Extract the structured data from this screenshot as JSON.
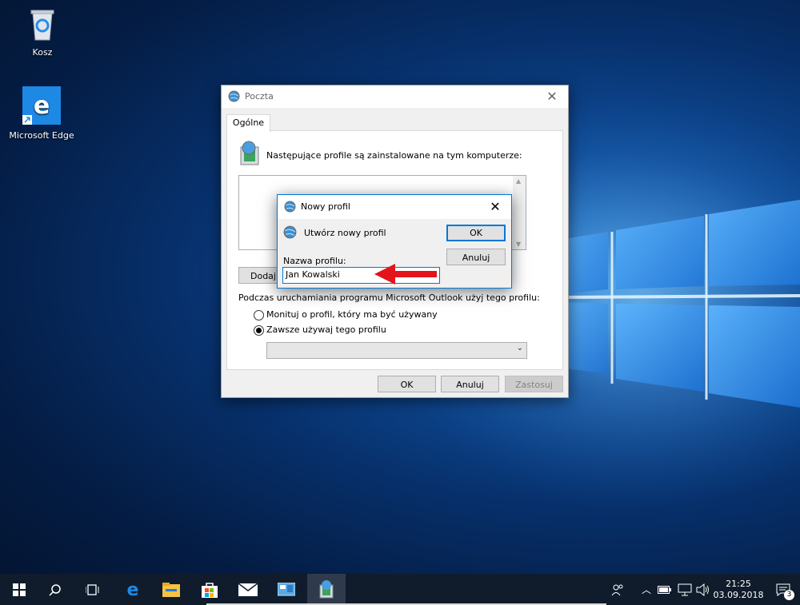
{
  "desktop": {
    "icons": [
      {
        "label": "Kosz",
        "icon": "recycle-bin-icon"
      },
      {
        "label": "Microsoft Edge",
        "icon": "edge-icon"
      }
    ]
  },
  "mail_dialog": {
    "title": "Poczta",
    "tab": "Ogólne",
    "header_text": "Następujące profile są zainstalowane na tym komputerze:",
    "add_button_partial": "Dodaj...",
    "startup_label": "Podczas uruchamiania programu Microsoft Outlook użyj tego profilu:",
    "radio_prompt": "Monituj o profil, który ma być używany",
    "radio_always": "Zawsze używaj tego profilu",
    "selected_radio": "radio_always",
    "profile_select_value": "",
    "ok": "OK",
    "cancel": "Anuluj",
    "apply": "Zastosuj"
  },
  "new_profile_dialog": {
    "title": "Nowy profil",
    "header_text": "Utwórz nowy profil",
    "field_label": "Nazwa profilu:",
    "field_value": "Jan Kowalski",
    "ok": "OK",
    "cancel": "Anuluj"
  },
  "annotation": {
    "color": "#e3141b",
    "icon": "red-arrow-icon"
  },
  "taskbar": {
    "items": [
      "start-icon",
      "search-icon",
      "task-view-icon",
      "edge-icon",
      "file-explorer-icon",
      "store-icon",
      "mail-icon",
      "control-panel-icon",
      "mail-profile-icon"
    ],
    "active": "mail-profile-icon",
    "time": "21:25",
    "date": "03.09.2018",
    "notification_count": "3",
    "accent": "#0078d7"
  }
}
